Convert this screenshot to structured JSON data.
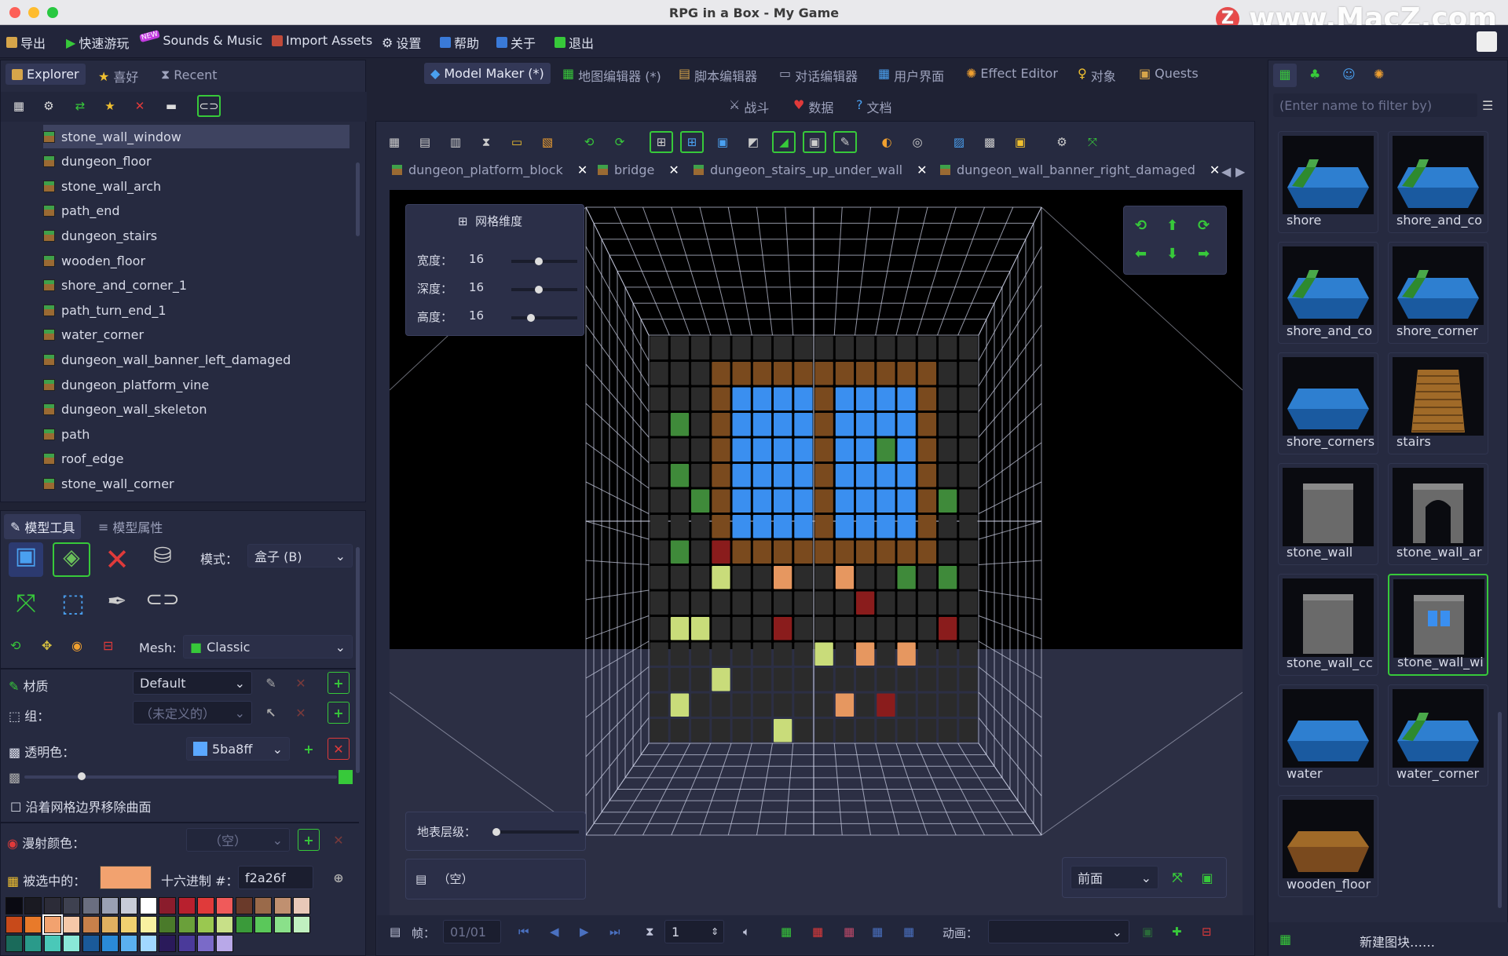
{
  "window": {
    "title": "RPG in a Box - My Game",
    "watermark": "www.MacZ.com"
  },
  "menu": {
    "export": "导出",
    "quick_play": "快速游玩",
    "new_badge": "NEW",
    "sounds_music": "Sounds & Music",
    "import_assets": "Import Assets",
    "settings": "设置",
    "help": "帮助",
    "about": "关于",
    "quit": "退出"
  },
  "left_tabs": {
    "explorer": "Explorer",
    "favorites": "喜好",
    "recent": "Recent"
  },
  "tree": {
    "items": [
      "stone_wall_window",
      "dungeon_floor",
      "stone_wall_arch",
      "path_end",
      "dungeon_stairs",
      "wooden_floor",
      "shore_and_corner_1",
      "path_turn_end_1",
      "water_corner",
      "dungeon_wall_banner_left_damaged",
      "dungeon_platform_vine",
      "dungeon_wall_skeleton",
      "path",
      "roof_edge",
      "stone_wall_corner"
    ]
  },
  "tool_tabs": {
    "model_tools": "模型工具",
    "model_props": "模型属性"
  },
  "tools": {
    "mode_label": "模式：",
    "mode_value": "盒子 (B)",
    "mesh_label": "Mesh:",
    "mesh_value": "Classic",
    "material_label": "材质",
    "material_value": "Default",
    "group_label": "组：",
    "group_value": "（未定义的）",
    "transparent_label": "透明色：",
    "transparent_value": "5ba8ff",
    "remove_faces": "沿着网格边界移除曲面",
    "diffuse_label": "漫射颜色：",
    "diffuse_value": "（空）",
    "selected_label": "被选中的：",
    "hex_label": "十六进制 #：",
    "hex_value": "f2a26f"
  },
  "palette": [
    "#0a0a12",
    "#1a1a22",
    "#2c2c38",
    "#3e4150",
    "#6a6e80",
    "#9aa0b4",
    "#c8ccd8",
    "#ffffff",
    "#8a1c2c",
    "#b8202e",
    "#e03a3a",
    "#f05a5a",
    "#6a3a2a",
    "#9a6a4a",
    "#c09070",
    "#e8c8b8",
    "#c84a1a",
    "#e87a2a",
    "#f2a26f",
    "#f5c8a8",
    "#c8804a",
    "#e0b060",
    "#f0d070",
    "#f8f0a0",
    "#4a7a2a",
    "#6aa03a",
    "#9ac850",
    "#c8e088",
    "#3a9a3a",
    "#5ac85a",
    "#8ae08a",
    "#c0f0c0",
    "#1a6a5a",
    "#2a9a8a",
    "#4ac8b8",
    "#8ae8d8",
    "#1a5a9a",
    "#2a8ad8",
    "#5ab0f0",
    "#a0d8ff",
    "#2a1a5a",
    "#4a3a9a",
    "#7a6ac8",
    "#b8a8e8"
  ],
  "editor_tabs": {
    "model_maker": "Model Maker (*)",
    "map_editor": "地图编辑器 (*)",
    "script_editor": "脚本编辑器",
    "dialog_editor": "对话编辑器",
    "ui": "用户界面",
    "effect_editor": "Effect Editor",
    "objects": "对象",
    "quests": "Quests",
    "combat": "战斗",
    "data": "数据",
    "docs": "文档"
  },
  "doc_tabs": [
    "dungeon_platform_block",
    "bridge",
    "dungeon_stairs_up_under_wall",
    "dungeon_wall_banner_right_damaged"
  ],
  "grid_dims": {
    "title": "网格维度",
    "width_label": "宽度：",
    "width": "16",
    "depth_label": "深度：",
    "depth": "16",
    "height_label": "高度：",
    "height": "16"
  },
  "ground_level": "地表层级：",
  "view_value": "前面",
  "frame_empty": "（空）",
  "bottom": {
    "frame_label": "帧：",
    "frame_value": "01/01",
    "duration": "1",
    "anim_label": "动画："
  },
  "right": {
    "filter_placeholder": "(Enter name to filter by)",
    "new_tile": "新建图块……",
    "tiles": [
      "shore",
      "shore_and_co",
      "shore_and_co",
      "shore_corner",
      "shore_corners",
      "stairs",
      "stone_wall",
      "stone_wall_ar",
      "stone_wall_cc",
      "stone_wall_wi",
      "water",
      "water_corner",
      "wooden_floor"
    ]
  },
  "colors": {
    "accent": "#37c93a",
    "window_blue": "#3a8ff0",
    "brick": "#7a4a1e",
    "slot": "#2b2b2b"
  }
}
